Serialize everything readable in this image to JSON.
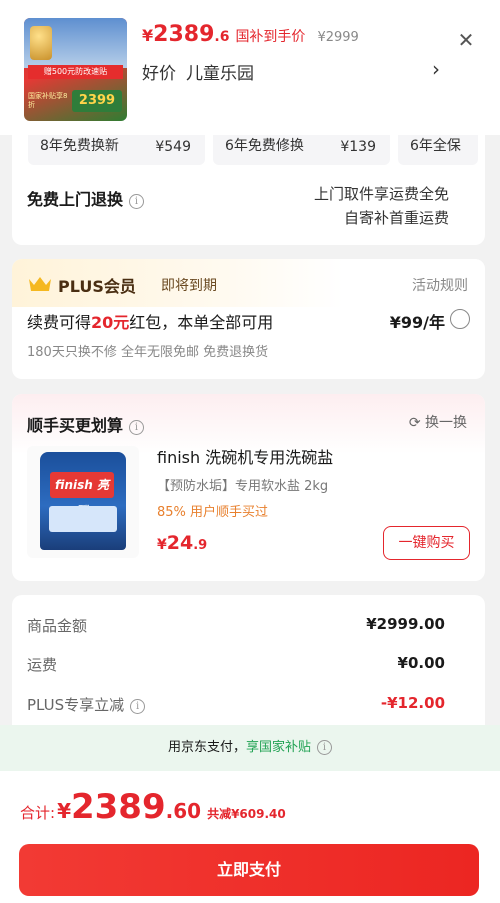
{
  "header": {
    "price_yen": "¥",
    "price_int": "2389",
    "price_dec": ".6",
    "price_tag": "国补到手价",
    "price_orig": "¥2999",
    "sub_a": "好价",
    "sub_b": "儿童乐园",
    "thumb": {
      "promo": "赠500元防改速贴",
      "deal_tag": "国家补贴享8折",
      "deal": "2399"
    }
  },
  "service": {
    "chips": [
      {
        "label": "8年免费换新",
        "price": "¥549"
      },
      {
        "label": "6年免费修换",
        "price": "¥139"
      },
      {
        "label": "6年全保",
        "price": ""
      }
    ],
    "door_label": "免费上门退换",
    "door_right_1": "上门取件享运费全免",
    "door_right_2": "自寄补首重运费"
  },
  "plus": {
    "title": "PLUS会员",
    "expire": "即将到期",
    "rule": "活动规则",
    "main_a": "续费可得",
    "main_hl": "20元",
    "main_b": "红包，本单全部可用",
    "price": "¥99/年",
    "desc": "180天只换不修 全年无限免邮 免费退换货",
    "crown_color": "#f5b820"
  },
  "recommend": {
    "title": "顺手买更划算",
    "swap": "换一换",
    "name": "finish 洗碗机专用洗碗盐",
    "spec": "【预防水垢】专用软水盐 2kg",
    "pct": "85% 用户顺手买过",
    "price_yen": "¥",
    "price_int": "24",
    "price_dec": ".9",
    "buy": "一键购买",
    "brand": "finish 亮碟"
  },
  "amount": {
    "goods_label": "商品金额",
    "goods_value": "¥2999.00",
    "ship_label": "运费",
    "ship_value": "¥0.00",
    "plus_label": "PLUS专享立减",
    "plus_value": "-¥12.00"
  },
  "pay_banner": {
    "a": "用京东支付，",
    "b": "享国家补贴"
  },
  "bottom": {
    "total_label": "合计:",
    "total_yen": "¥",
    "total_int": "2389",
    "total_dec": ".60",
    "save": "共减¥609.40",
    "pay_button": "立即支付"
  },
  "colors": {
    "accent_red": "#e4262d",
    "green": "#21a253",
    "orange": "#e8802e"
  }
}
